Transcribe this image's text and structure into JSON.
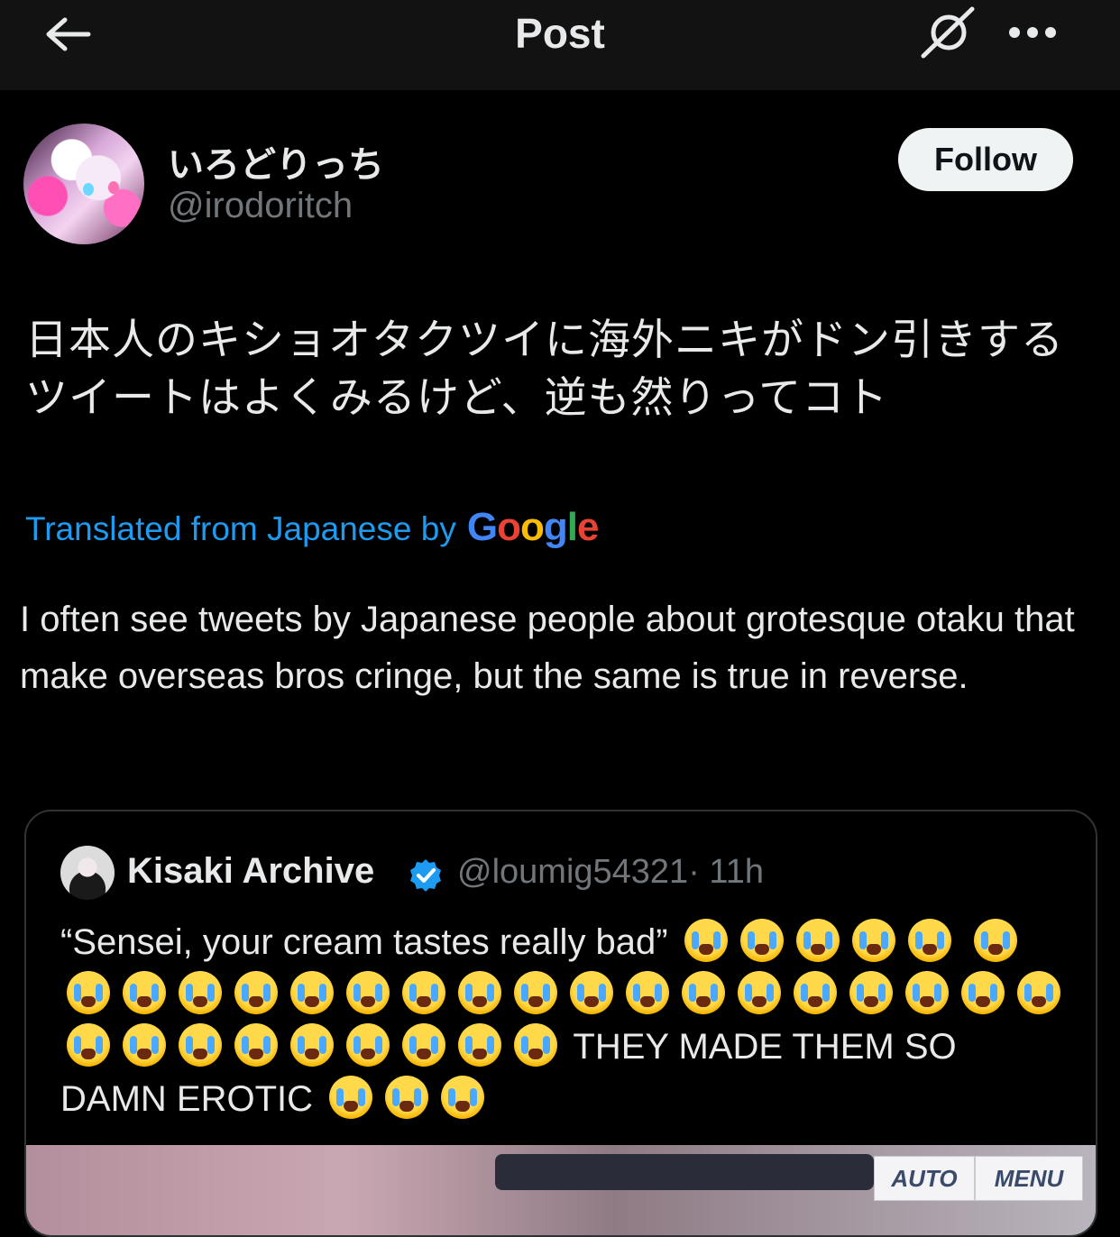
{
  "header": {
    "title": "Post",
    "back_icon": "arrow-left-icon",
    "grok_icon": "grok-icon",
    "more_icon": "more-horizontal-icon"
  },
  "post": {
    "author": {
      "display_name": "いろどりっち",
      "handle": "@irodoritch"
    },
    "follow_label": "Follow",
    "original_text": "日本人のキショオタクツイに海外ニキがドン引きするツイートはよくみるけど、逆も然りってコト",
    "translation_label": "Translated from Japanese by",
    "translation_provider": "Google",
    "translated_text": "I often see tweets by Japanese people about grotesque otaku that make overseas bros cringe, but the same is true in reverse."
  },
  "quote": {
    "author": {
      "display_name": "Kisaki Archive",
      "verified": true,
      "handle": "@loumig54321",
      "time": "· 11h"
    },
    "text_part1": "“Sensei, your cream tastes really bad”",
    "text_part2": "THEY MADE THEM SO DAMN EROTIC",
    "emoji_name": "loudly-crying-face",
    "emoji_groups": [
      5,
      28,
      3
    ],
    "media": {
      "auto_label": "AUTO",
      "menu_label": "MENU"
    }
  },
  "colors": {
    "background": "#000000",
    "header_bg": "#121212",
    "text": "#e7e9ea",
    "muted": "#71767b",
    "link": "#1d9bf0",
    "verified": "#1d9bf0"
  }
}
